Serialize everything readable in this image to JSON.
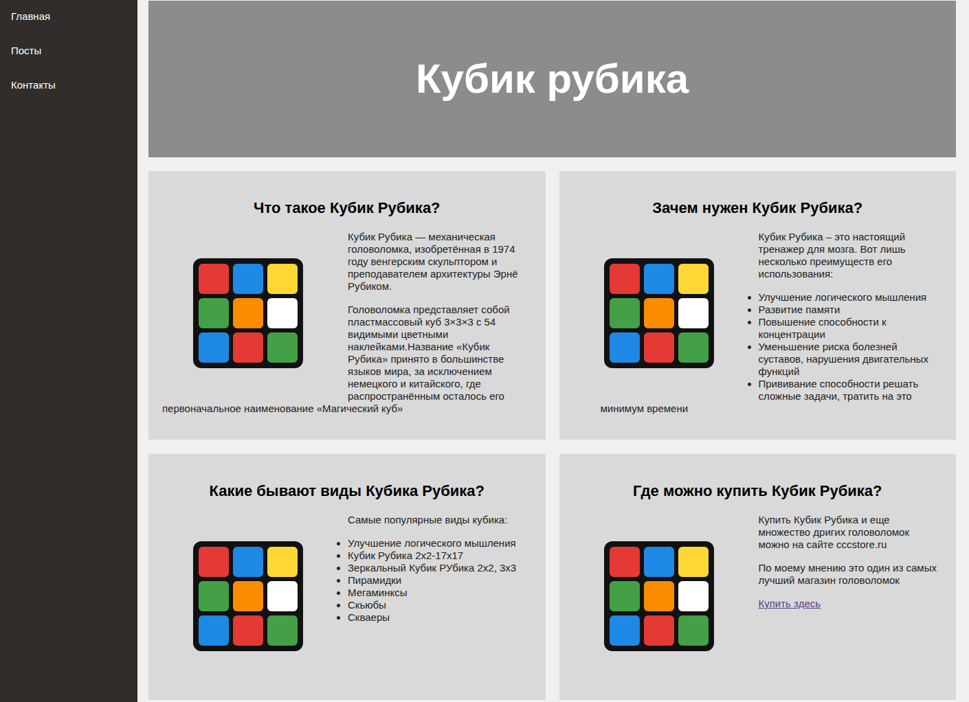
{
  "sidebar": {
    "items": [
      {
        "label": "Главная"
      },
      {
        "label": "Посты"
      },
      {
        "label": "Контакты"
      }
    ]
  },
  "header": {
    "title": "Кубик рубика"
  },
  "cards": [
    {
      "title": "Что такое Кубик Рубика?",
      "blocks": [
        {
          "kind": "paragraph",
          "text": "Кубик Рубика — механическая головоломка, изобретённая в 1974 году венгерским скульптором и преподавателем архитектуры Эрнё Рубиком."
        },
        {
          "kind": "paragraph",
          "text": "Головоломка представляет собой пластмассовый куб 3×3×3 с 54 видимыми цветными наклейками.Название «Кубик Рубика» принято в большинстве языков мира, за исключением немецкого и китайского, где распространённым осталось его первоначальное наименование «Магический куб»"
        }
      ]
    },
    {
      "title": "Зачем нужен Кубик Рубика?",
      "blocks": [
        {
          "kind": "paragraph",
          "text": "Кубик Рубика – это настоящий тренажер для мозга. Вот лишь несколько преимуществ его использования:"
        },
        {
          "kind": "list",
          "items": [
            "Улучшение логического мышления",
            "Развитие памяти",
            "Повышение способности к концентрации",
            "Уменьшение риска болезней суставов, нарушения двигательных функций",
            "Прививание способности решать сложные задачи, тратить на это минимум времени"
          ]
        }
      ]
    },
    {
      "title": "Какие бывают виды Кубика Рубика?",
      "blocks": [
        {
          "kind": "paragraph",
          "text": "Самые популярные виды кубика:"
        },
        {
          "kind": "list",
          "items": [
            "Улучшение логического мышления",
            "Кубик Рубика 2x2-17x17",
            "Зеркальный Кубик РУбика 2x2, 3x3",
            "Пирамидки",
            "Мегаминксы",
            "Скьюбы",
            "Скваеры"
          ]
        }
      ]
    },
    {
      "title": "Где можно купить Кубик Рубика?",
      "blocks": [
        {
          "kind": "paragraph",
          "text": "Купить Кубик Рубика и еще множество дригих головоломок можно на сайте cccstore.ru"
        },
        {
          "kind": "paragraph",
          "text": "По моему мнению это один из самых лучший магазин головоломок"
        },
        {
          "kind": "link",
          "text": "Купить здесь"
        }
      ]
    }
  ]
}
